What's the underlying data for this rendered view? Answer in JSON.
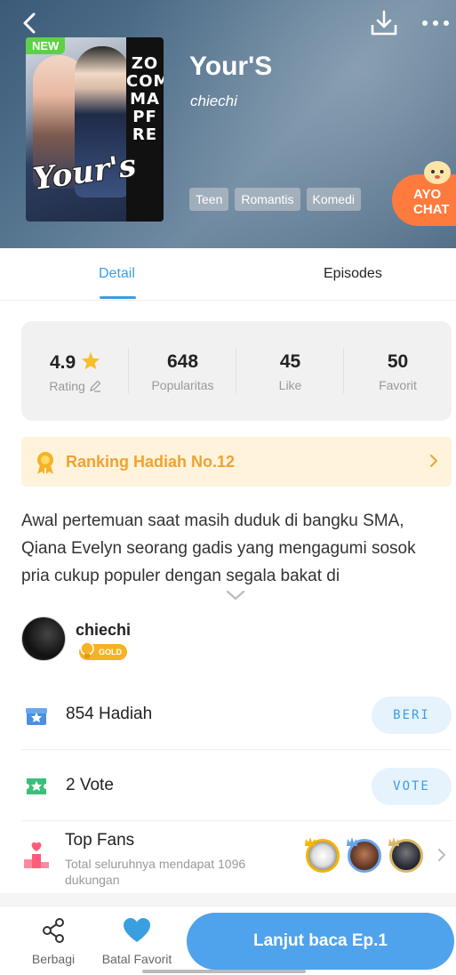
{
  "header": {
    "title": "Your'S",
    "author": "chiechi",
    "tags": [
      "Teen",
      "Romantis",
      "Komedi"
    ],
    "cover": {
      "badge": "NEW",
      "title_text": "Your's",
      "side_text": [
        "ZO",
        "COM",
        "MA",
        "PF",
        "RE"
      ]
    },
    "chat_button": [
      "AYO",
      "CHAT"
    ]
  },
  "tabs": {
    "detail": "Detail",
    "episodes": "Episodes",
    "active": "Detail"
  },
  "stats": {
    "rating": {
      "value": "4.9",
      "label": "Rating"
    },
    "popularity": {
      "value": "648",
      "label": "Popularitas"
    },
    "like": {
      "value": "45",
      "label": "Like"
    },
    "favorit": {
      "value": "50",
      "label": "Favorit"
    }
  },
  "ranking": {
    "text": "Ranking Hadiah No.12"
  },
  "description": "Awal pertemuan saat masih duduk di bangku SMA, Qiana Evelyn seorang gadis yang mengagumi sosok pria cukup populer dengan segala bakat di",
  "author_section": {
    "name": "chiechi",
    "badge": "GOLD"
  },
  "gift_row": {
    "count": "854",
    "label": "Hadiah",
    "button": "BERI"
  },
  "vote_row": {
    "count": "2",
    "label": "Vote",
    "button": "VOTE"
  },
  "top_fans": {
    "title": "Top Fans",
    "subtitle": "Total seluruhnya mendapat 1096 dukungan"
  },
  "bottom_bar": {
    "share_label": "Berbagi",
    "favorite_label": "Batal Favorit",
    "read_button": "Lanjut baca Ep.1"
  },
  "colors": {
    "accent": "#3a9fe0",
    "read_button": "#4ea3ec",
    "ranking_text": "#f0a230",
    "ranking_bg": "#fff3dc",
    "chat_button": "#ff7a3d",
    "new_badge": "#5ed04a"
  }
}
